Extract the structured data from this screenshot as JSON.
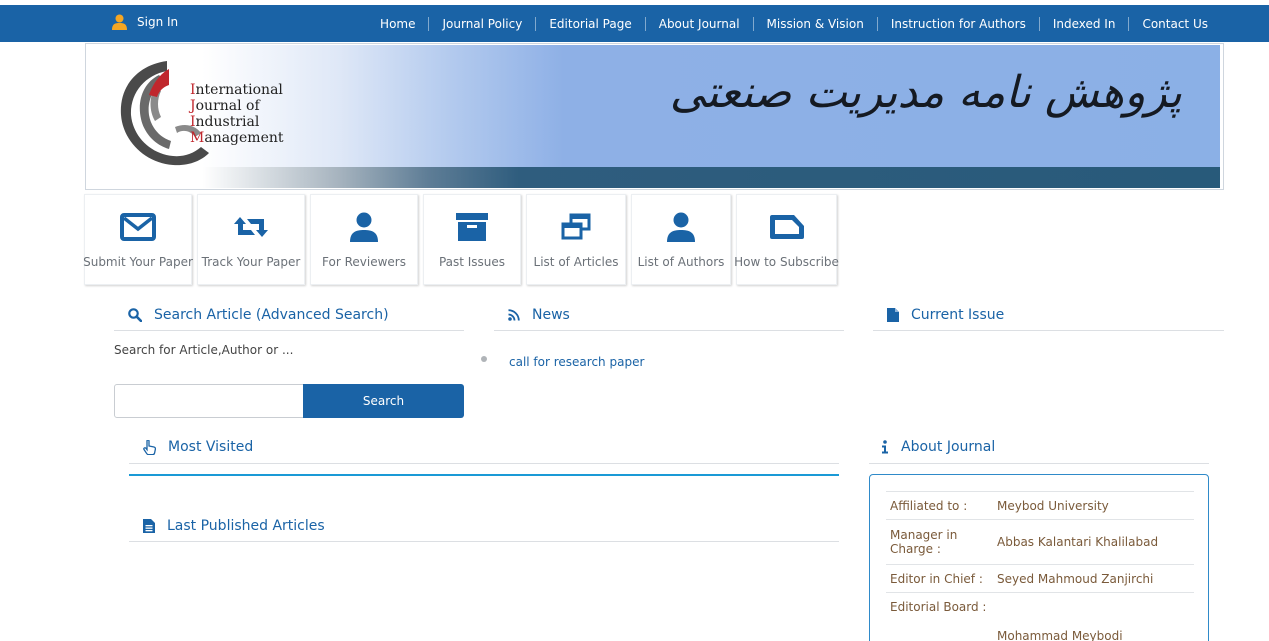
{
  "topbar": {
    "signin_label": "Sign In",
    "nav": [
      "Home",
      "Journal Policy",
      "Editorial Page",
      "About Journal",
      "Mission & Vision",
      "Instruction for Authors",
      "Indexed In",
      "Contact Us"
    ]
  },
  "banner": {
    "logo_lines": [
      {
        "initial": "I",
        "rest": "nternational"
      },
      {
        "initial": "J",
        "rest": "ournal of"
      },
      {
        "initial": "I",
        "rest": "ndustrial"
      },
      {
        "initial": "M",
        "rest": "anagement"
      }
    ],
    "persian_title": "پژوهش نامه مدیریت صنعتی"
  },
  "tiles": [
    {
      "label": "Submit Your Paper",
      "icon": "envelope-icon"
    },
    {
      "label": "Track Your Paper",
      "icon": "retweet-icon"
    },
    {
      "label": "For Reviewers",
      "icon": "user-icon"
    },
    {
      "label": "Past Issues",
      "icon": "archive-icon"
    },
    {
      "label": "List of Articles",
      "icon": "windows-icon"
    },
    {
      "label": "List of Authors",
      "icon": "user-icon"
    },
    {
      "label": "How to Subscribe",
      "icon": "tag-icon"
    }
  ],
  "search": {
    "title": "Search Article (Advanced Search)",
    "hint": "Search for Article,Author or ...",
    "input_value": "",
    "button_label": "Search"
  },
  "news": {
    "title": "News",
    "items": [
      "call for research paper"
    ]
  },
  "current_issue": {
    "title": "Current Issue"
  },
  "most_visited": {
    "title": "Most Visited"
  },
  "last_published": {
    "title": "Last Published Articles"
  },
  "about": {
    "title": "About Journal",
    "rows": [
      {
        "key": "Affiliated to :",
        "value": "Meybod University"
      },
      {
        "key": "Manager in Charge :",
        "value": "Abbas Kalantari Khalilabad"
      },
      {
        "key": "Editor in Chief :",
        "value": "Seyed Mahmoud Zanjirchi"
      },
      {
        "key": "Editorial Board :",
        "value": ""
      },
      {
        "key": "",
        "value": "Mohammad Meybodi"
      }
    ]
  },
  "colors": {
    "accent": "#1a63a6",
    "highlight": "#1a9ad6",
    "logo_red": "#c0272d"
  }
}
